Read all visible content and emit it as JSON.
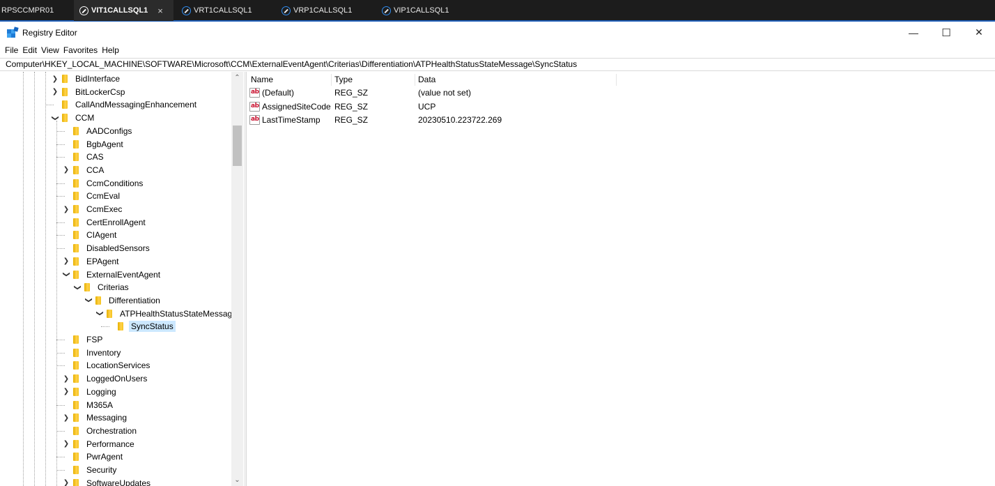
{
  "remote_tabs": [
    {
      "label": "RPSCCMPR01",
      "active": false,
      "has_icon": false
    },
    {
      "label": "VIT1CALLSQL1",
      "active": true,
      "has_icon": true,
      "close": "×"
    },
    {
      "label": "VRT1CALLSQL1",
      "active": false,
      "has_icon": true
    },
    {
      "label": "VRP1CALLSQL1",
      "active": false,
      "has_icon": true
    },
    {
      "label": "VIP1CALLSQL1",
      "active": false,
      "has_icon": true
    }
  ],
  "window": {
    "title": "Registry Editor",
    "icon": "registry-editor-icon",
    "controls": {
      "minimize": "—",
      "maximize": "☐",
      "close": "✕"
    }
  },
  "menu": [
    "File",
    "Edit",
    "View",
    "Favorites",
    "Help"
  ],
  "address": "Computer\\HKEY_LOCAL_MACHINE\\SOFTWARE\\Microsoft\\CCM\\ExternalEventAgent\\Criterias\\Differentiation\\ATPHealthStatusStateMessage\\SyncStatus",
  "tree": [
    {
      "label": "BidInterface",
      "level": 0,
      "expander": "collapsed"
    },
    {
      "label": "BitLockerCsp",
      "level": 0,
      "expander": "collapsed"
    },
    {
      "label": "CallAndMessagingEnhancement",
      "level": 0,
      "expander": "none"
    },
    {
      "label": "CCM",
      "level": 0,
      "expander": "expanded"
    },
    {
      "label": "AADConfigs",
      "level": 1,
      "expander": "none"
    },
    {
      "label": "BgbAgent",
      "level": 1,
      "expander": "none"
    },
    {
      "label": "CAS",
      "level": 1,
      "expander": "none"
    },
    {
      "label": "CCA",
      "level": 1,
      "expander": "collapsed"
    },
    {
      "label": "CcmConditions",
      "level": 1,
      "expander": "none"
    },
    {
      "label": "CcmEval",
      "level": 1,
      "expander": "none"
    },
    {
      "label": "CcmExec",
      "level": 1,
      "expander": "collapsed"
    },
    {
      "label": "CertEnrollAgent",
      "level": 1,
      "expander": "none"
    },
    {
      "label": "CIAgent",
      "level": 1,
      "expander": "none"
    },
    {
      "label": "DisabledSensors",
      "level": 1,
      "expander": "none"
    },
    {
      "label": "EPAgent",
      "level": 1,
      "expander": "collapsed"
    },
    {
      "label": "ExternalEventAgent",
      "level": 1,
      "expander": "expanded"
    },
    {
      "label": "Criterias",
      "level": 2,
      "expander": "expanded"
    },
    {
      "label": "Differentiation",
      "level": 3,
      "expander": "expanded"
    },
    {
      "label": "ATPHealthStatusStateMessage",
      "level": 4,
      "expander": "expanded"
    },
    {
      "label": "SyncStatus",
      "level": 5,
      "expander": "none",
      "selected": true
    },
    {
      "label": "FSP",
      "level": 1,
      "expander": "none"
    },
    {
      "label": "Inventory",
      "level": 1,
      "expander": "none"
    },
    {
      "label": "LocationServices",
      "level": 1,
      "expander": "none"
    },
    {
      "label": "LoggedOnUsers",
      "level": 1,
      "expander": "collapsed"
    },
    {
      "label": "Logging",
      "level": 1,
      "expander": "collapsed"
    },
    {
      "label": "M365A",
      "level": 1,
      "expander": "none"
    },
    {
      "label": "Messaging",
      "level": 1,
      "expander": "collapsed"
    },
    {
      "label": "Orchestration",
      "level": 1,
      "expander": "none"
    },
    {
      "label": "Performance",
      "level": 1,
      "expander": "collapsed"
    },
    {
      "label": "PwrAgent",
      "level": 1,
      "expander": "none"
    },
    {
      "label": "Security",
      "level": 1,
      "expander": "none"
    },
    {
      "label": "SoftwareUpdates",
      "level": 1,
      "expander": "collapsed"
    }
  ],
  "columns": [
    "Name",
    "Type",
    "Data"
  ],
  "values": [
    {
      "name": "(Default)",
      "type": "REG_SZ",
      "data": "(value not set)",
      "icon": "string-value-icon",
      "icon_text": "ab"
    },
    {
      "name": "AssignedSiteCode",
      "type": "REG_SZ",
      "data": "UCP",
      "icon": "string-value-icon",
      "icon_text": "ab"
    },
    {
      "name": "LastTimeStamp",
      "type": "REG_SZ",
      "data": "20230510.223722.269",
      "icon": "string-value-icon",
      "icon_text": "ab"
    }
  ],
  "scrollbar": {
    "up": "⌃",
    "down": "⌄"
  },
  "colors": {
    "selection": "#cce8ff",
    "folder": "#f4c21a",
    "rd_accent": "#1f5fb8"
  }
}
